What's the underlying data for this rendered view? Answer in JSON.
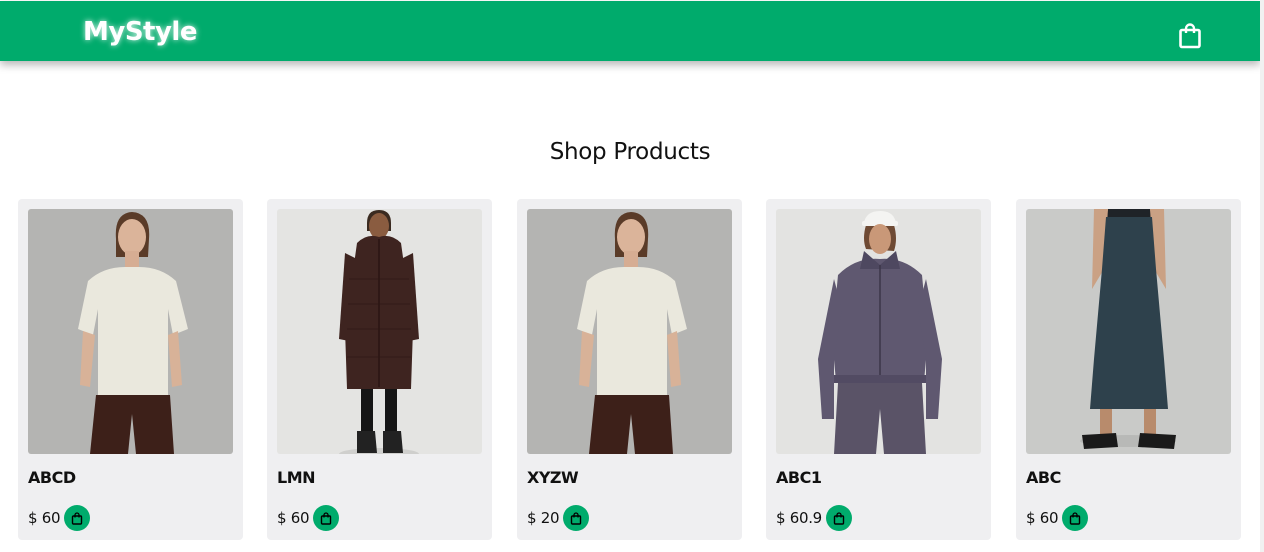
{
  "header": {
    "brand": "MyStyle",
    "cart_icon": "shopping-bag-icon",
    "accent_color": "#00ab6c"
  },
  "main": {
    "title": "Shop Products"
  },
  "products": [
    {
      "name": "ABCD",
      "price": "$ 60",
      "image": "woman-cream-tshirt-brown-pants"
    },
    {
      "name": "LMN",
      "price": "$ 60",
      "image": "woman-long-brown-puffer-coat"
    },
    {
      "name": "XYZW",
      "price": "$ 20",
      "image": "woman-cream-tshirt-brown-pants"
    },
    {
      "name": "ABC1",
      "price": "$ 60.9",
      "image": "woman-purple-zip-hoodie-white-cap"
    },
    {
      "name": "ABC",
      "price": "$ 60",
      "image": "woman-navy-midi-skirt-sandals"
    }
  ]
}
